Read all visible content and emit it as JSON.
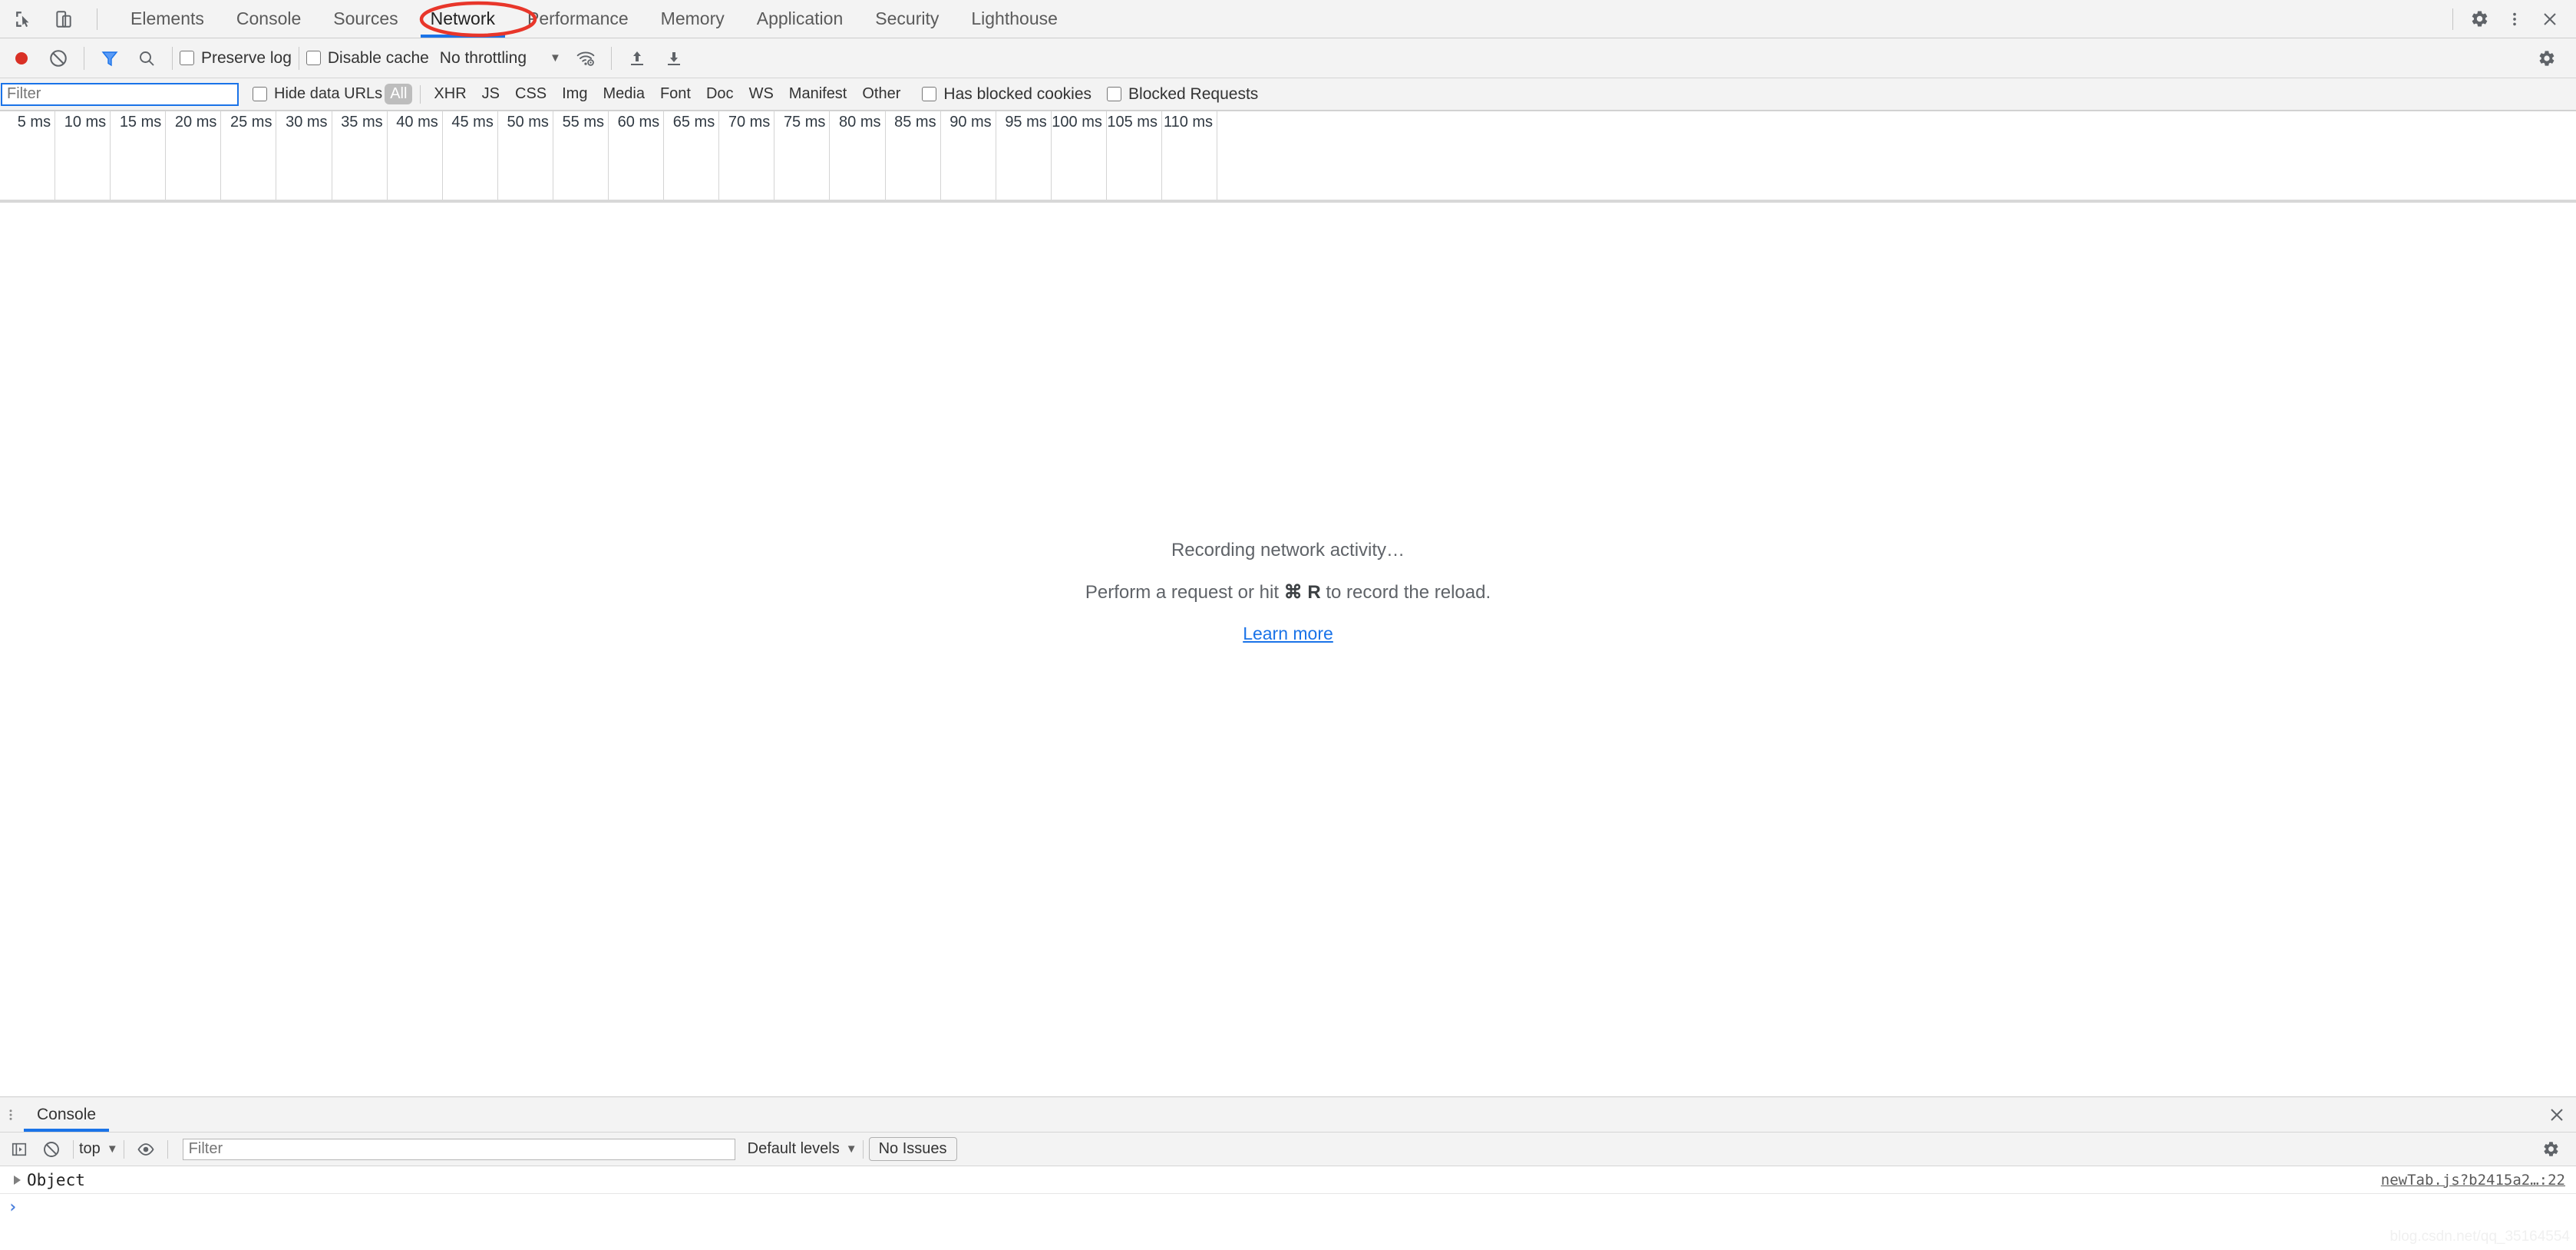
{
  "tabbar": {
    "inspect_icon": "inspect-element-icon",
    "device_icon": "device-toolbar-icon",
    "tabs": [
      {
        "label": "Elements",
        "selected": false
      },
      {
        "label": "Console",
        "selected": false
      },
      {
        "label": "Sources",
        "selected": false
      },
      {
        "label": "Network",
        "selected": true
      },
      {
        "label": "Performance",
        "selected": false
      },
      {
        "label": "Memory",
        "selected": false
      },
      {
        "label": "Application",
        "selected": false
      },
      {
        "label": "Security",
        "selected": false
      },
      {
        "label": "Lighthouse",
        "selected": false
      }
    ],
    "settings_icon": "gear-icon",
    "more_icon": "more-vertical-icon",
    "close_icon": "close-icon",
    "accent_color": "#1a73e8",
    "annotation_color": "#e8362a"
  },
  "network_toolbar": {
    "record_label": "record-button",
    "record_color": "#d93025",
    "clear_label": "clear-button",
    "filter_icon": "funnel-icon",
    "filter_icon_color": "#1a73e8",
    "search_icon": "search-icon",
    "preserve_log": {
      "label": "Preserve log",
      "checked": false
    },
    "disable_cache": {
      "label": "Disable cache",
      "checked": false
    },
    "throttling": {
      "value": "No throttling",
      "caret": "▼"
    },
    "wifi_icon": "wifi-settings-icon",
    "import_icon": "upload-har-icon",
    "export_icon": "download-har-icon",
    "settings_icon": "gear-icon"
  },
  "filter_bar": {
    "filter_placeholder": "Filter",
    "filter_value": "",
    "hide_data_urls": {
      "label": "Hide data URLs",
      "checked": false
    },
    "types": [
      {
        "label": "All",
        "active": true
      },
      {
        "label": "XHR",
        "active": false
      },
      {
        "label": "JS",
        "active": false
      },
      {
        "label": "CSS",
        "active": false
      },
      {
        "label": "Img",
        "active": false
      },
      {
        "label": "Media",
        "active": false
      },
      {
        "label": "Font",
        "active": false
      },
      {
        "label": "Doc",
        "active": false
      },
      {
        "label": "WS",
        "active": false
      },
      {
        "label": "Manifest",
        "active": false
      },
      {
        "label": "Other",
        "active": false
      }
    ],
    "has_blocked_cookies": {
      "label": "Has blocked cookies",
      "checked": false
    },
    "blocked_requests": {
      "label": "Blocked Requests",
      "checked": false
    }
  },
  "overview": {
    "ticks": [
      "5 ms",
      "10 ms",
      "15 ms",
      "20 ms",
      "25 ms",
      "30 ms",
      "35 ms",
      "40 ms",
      "45 ms",
      "50 ms",
      "55 ms",
      "60 ms",
      "65 ms",
      "70 ms",
      "75 ms",
      "80 ms",
      "85 ms",
      "90 ms",
      "95 ms",
      "100 ms",
      "105 ms",
      "110 ms"
    ]
  },
  "empty_state": {
    "line1": "Recording network activity…",
    "line2_before": "Perform a request or hit ",
    "line2_kbd": "⌘ R",
    "line2_after": " to record the reload.",
    "link": "Learn more"
  },
  "drawer": {
    "more_icon": "more-vertical-icon",
    "tab_label": "Console",
    "close_icon": "close-icon",
    "toolbar": {
      "sidebar_icon": "console-sidebar-icon",
      "clear_icon": "clear-console-icon",
      "context": "top",
      "context_caret": "▼",
      "eye_icon": "live-expression-icon",
      "filter_placeholder": "Filter",
      "filter_value": "",
      "levels": "Default levels",
      "levels_caret": "▼",
      "issues": "No Issues",
      "settings_icon": "gear-icon"
    },
    "messages": [
      {
        "expander": "▶",
        "text": "Object",
        "source": "newTab.js?b2415a2…:22"
      }
    ],
    "prompt": "›"
  },
  "watermark": "blog.csdn.net/qq_35164554"
}
